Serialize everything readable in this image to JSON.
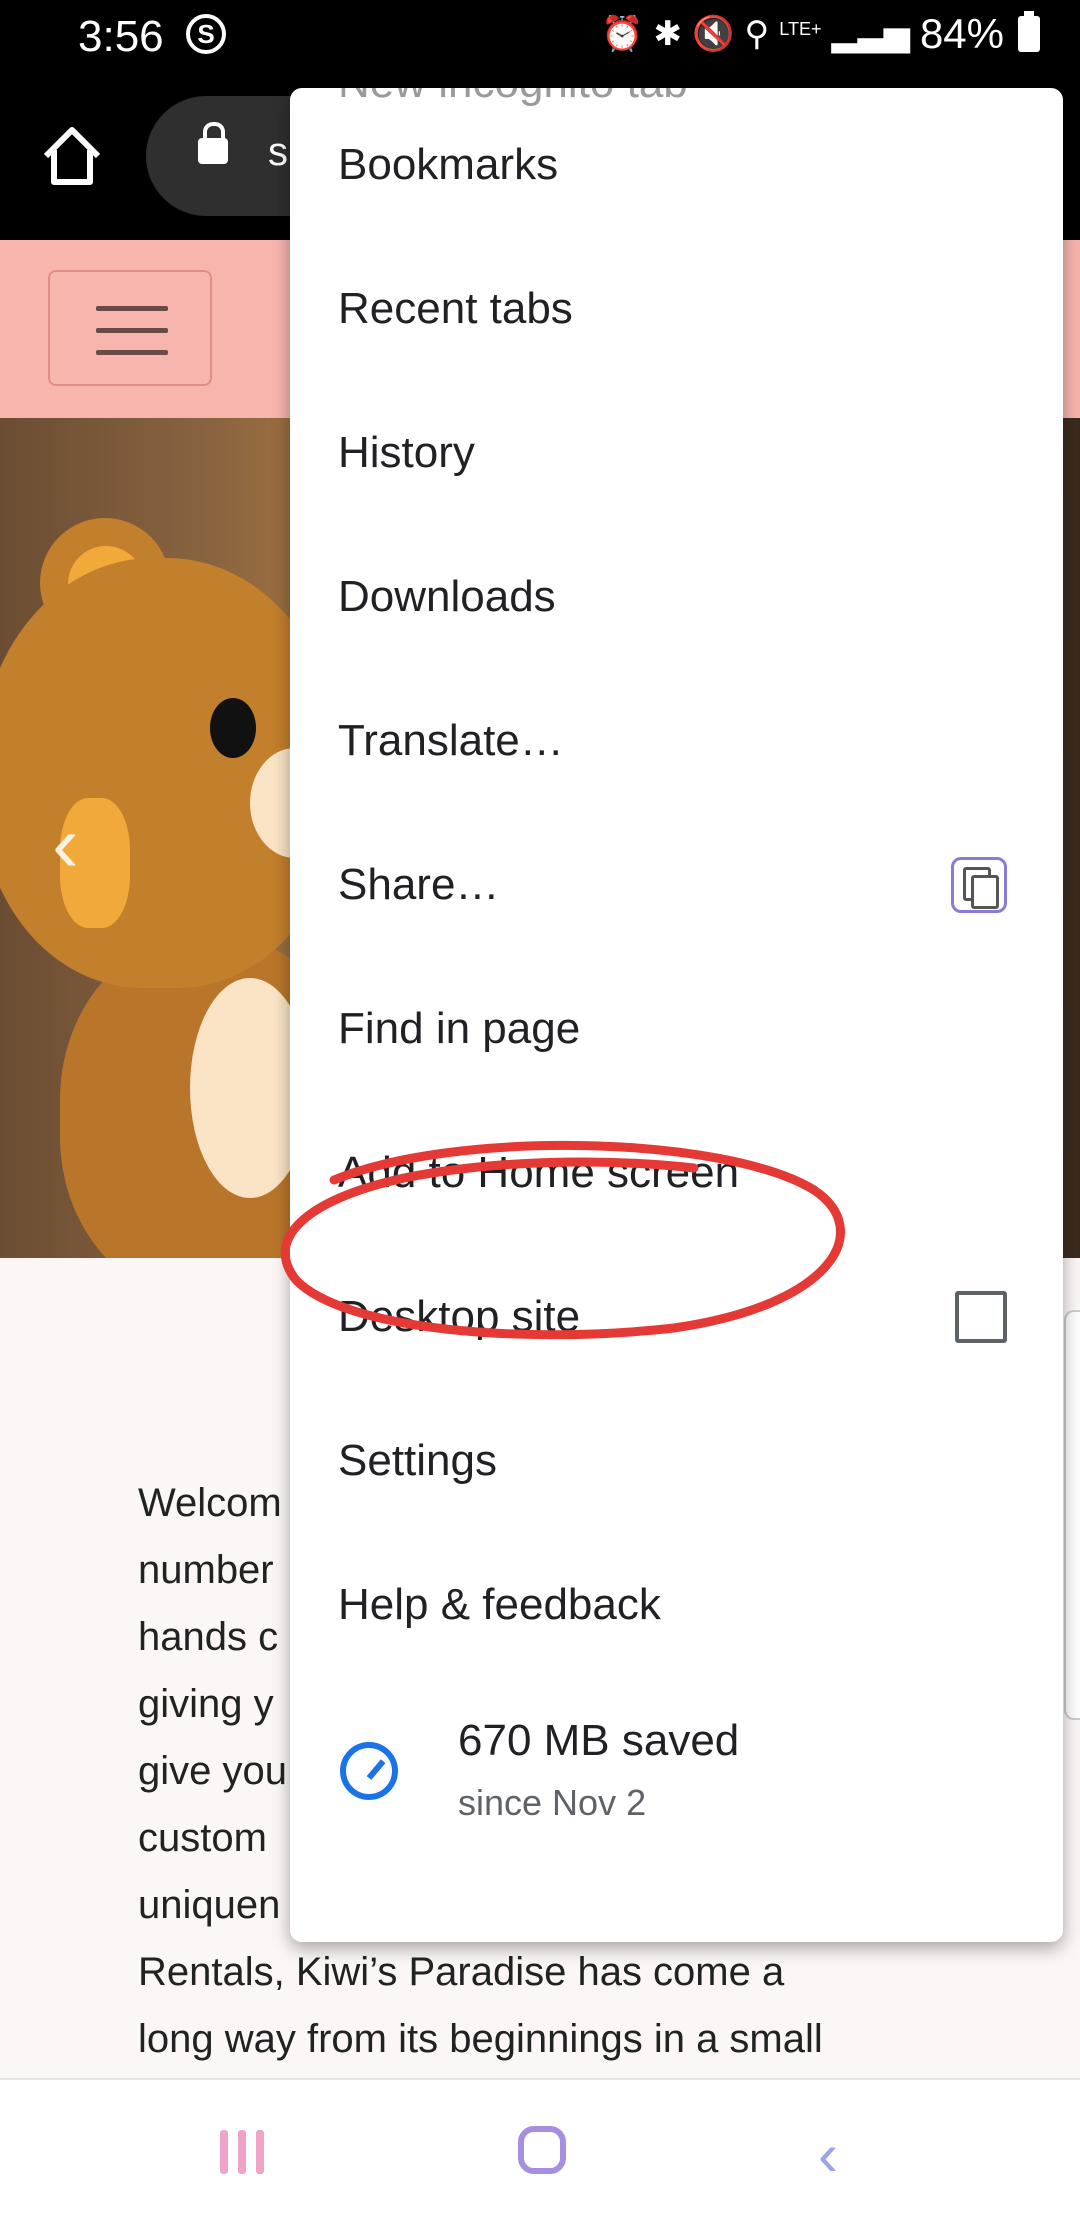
{
  "status_bar": {
    "time": "3:56",
    "app_icon": "S",
    "network": "LTE+",
    "battery": "84%",
    "icons": [
      "alarm-icon",
      "bluetooth-icon",
      "mute-icon",
      "location-icon",
      "signal-icon",
      "battery-icon"
    ]
  },
  "toolbar": {
    "url_partial": "s"
  },
  "page": {
    "body_lines": [
      "Welcom",
      "number",
      "hands c",
      "giving y",
      "give you",
      "custom",
      "uniquen",
      "Rentals, Kiwi’s Paradise has come a",
      "long way from its beginnings in a small"
    ]
  },
  "menu": {
    "items": [
      {
        "label": "New incognito tab"
      },
      {
        "label": "Bookmarks"
      },
      {
        "label": "Recent tabs"
      },
      {
        "label": "History"
      },
      {
        "label": "Downloads"
      },
      {
        "label": "Translate…"
      },
      {
        "label": "Share…"
      },
      {
        "label": "Find in page"
      },
      {
        "label": "Add to Home screen"
      },
      {
        "label": "Desktop site",
        "checked": false
      },
      {
        "label": "Settings"
      },
      {
        "label": "Help & feedback"
      }
    ],
    "data_saver": {
      "main": "670 MB saved",
      "sub": "since Nov 2"
    }
  },
  "colors": {
    "site_header": "#f8b5ae",
    "annotation_circle": "#e53935",
    "saver_icon": "#1a73e8"
  }
}
